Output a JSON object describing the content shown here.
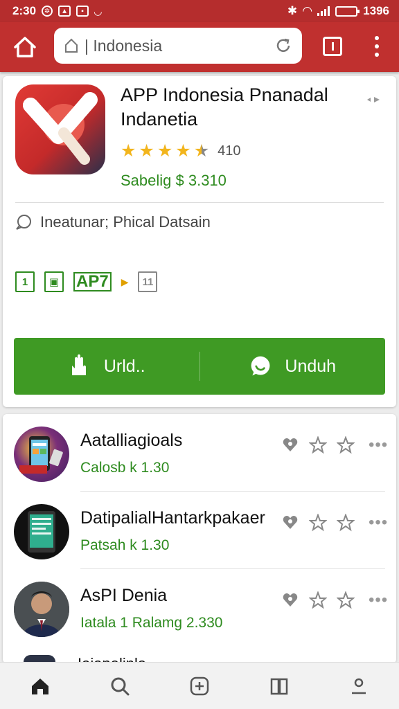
{
  "status_bar": {
    "time": "2:30",
    "battery_right_text": "1396",
    "battery_level_fraction": 0.85
  },
  "toolbar": {
    "url_text": "| Indonesia"
  },
  "app": {
    "title": "APP Indonesia Pnanadal Indanetia",
    "rating_count": "410",
    "rating_stars": 4.5,
    "seller": "Sabelig $ 3.310",
    "info_text": "Ineatunar; Phical Datsain",
    "badge1": "1",
    "badge3_text": "AP7",
    "badge4": "11",
    "download_left_label": "Urld..",
    "download_right_label": "Unduh"
  },
  "list": [
    {
      "title": "Aatalliagioals",
      "subtitle": "Calosb k 1.30"
    },
    {
      "title": "DatipalialHantarkpakaer",
      "subtitle": "Patsah k 1.30"
    },
    {
      "title": "AsPI Denia",
      "subtitle": "Iatala  1 Ralamg 2.330"
    }
  ],
  "peek_text": "Iaianalinla",
  "bottom_nav": [
    "home-icon",
    "search-icon",
    "add-icon",
    "book-icon",
    "profile-icon"
  ],
  "colors": {
    "toolbar": "#c0302f",
    "accent_green": "#3f9a24",
    "text_green": "#2e8b1f",
    "star": "#f2b51d"
  }
}
